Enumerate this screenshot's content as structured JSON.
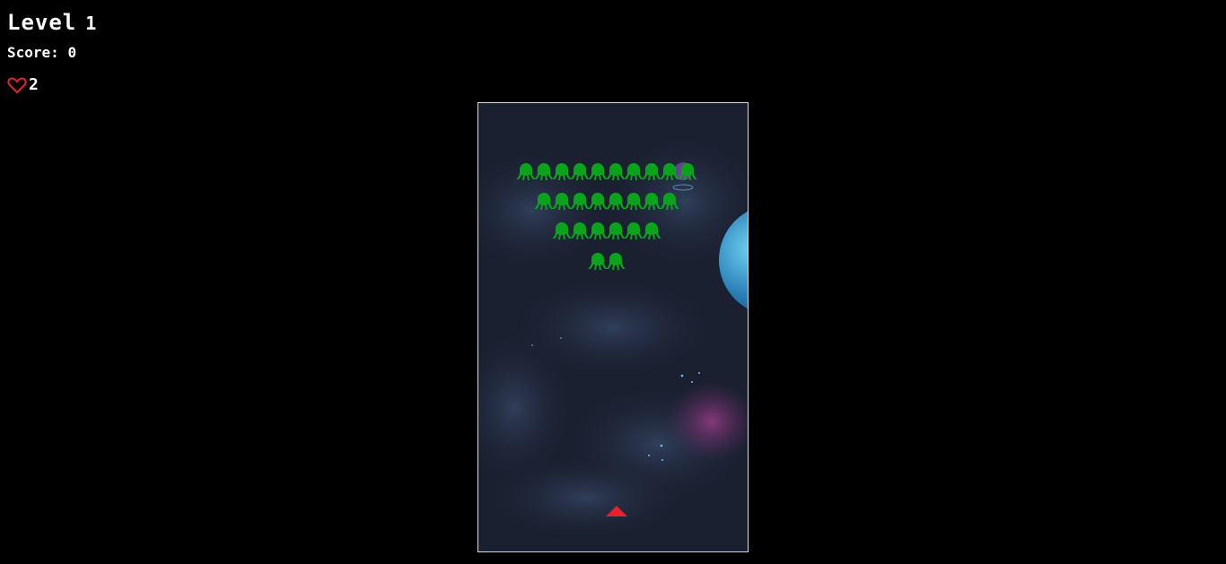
{
  "hud": {
    "level_label": "Level",
    "level_value": "1",
    "score_label": "Score:",
    "score_value": "0",
    "lives_icon": "heart-outline-icon",
    "lives_value": "2"
  },
  "game": {
    "alien_color": "#0aa41c",
    "player_color": "#e8222c",
    "alien_rows": [
      10,
      8,
      6,
      2
    ]
  }
}
